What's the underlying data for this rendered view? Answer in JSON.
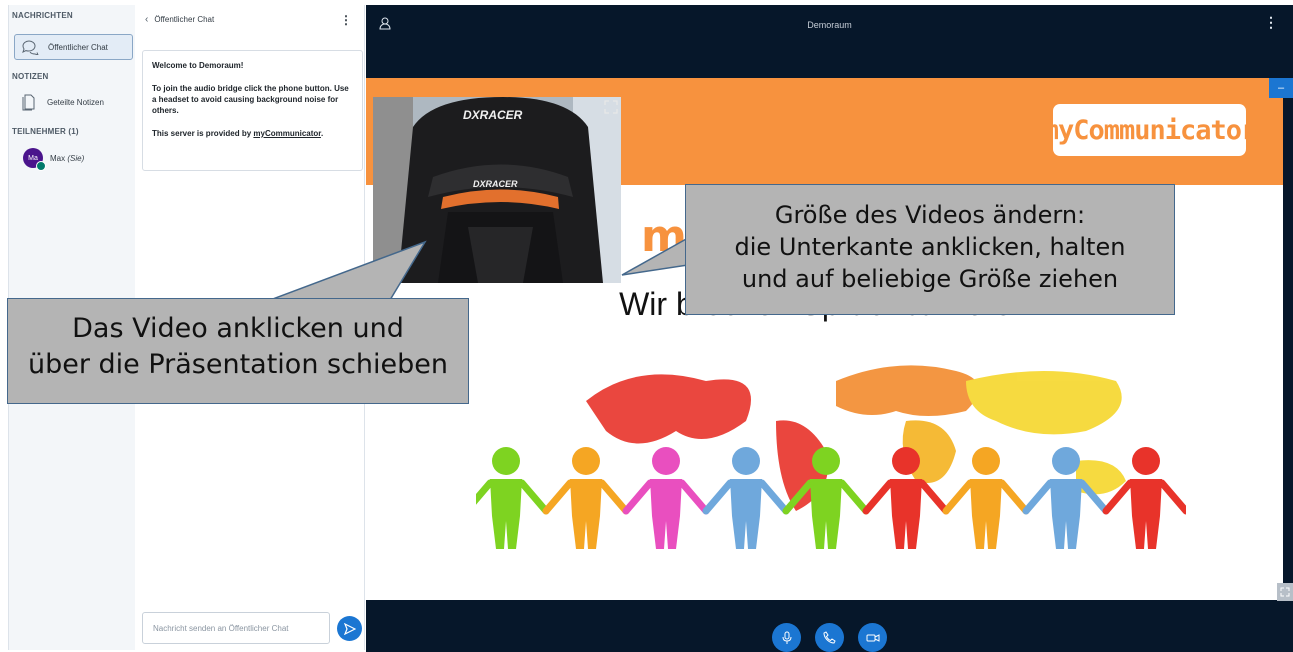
{
  "sidebar": {
    "messages_title": "NACHRICHTEN",
    "public_chat_label": "Öffentlicher Chat",
    "notes_title": "NOTIZEN",
    "shared_notes_label": "Geteilte Notizen",
    "participants_title": "TEILNEHMER (1)",
    "user": {
      "initials": "Ma",
      "name": "Max",
      "suffix": "(Sie)"
    }
  },
  "chat": {
    "header_title": "Öffentlicher Chat",
    "welcome_prefix": "Welcome to ",
    "welcome_room": "Demoraum",
    "welcome_suffix": "!",
    "instructions": "To join the audio bridge click the phone button. Use a headset to avoid causing background noise for others.",
    "provider_prefix": "This server is provided by ",
    "provider_link": "myCommunicator",
    "provider_suffix": ".",
    "input_placeholder": "Nachricht senden an Öffentlicher Chat"
  },
  "main": {
    "room_title": "Demoraum",
    "minimize_label": "–"
  },
  "slide": {
    "logo_text": "myCommunicator",
    "partial_heading": "m",
    "subtitle": "Wir brechen Sprachbarrieren"
  },
  "video": {
    "brand_top": "DXRACER",
    "brand_bottom": "DXRACER"
  },
  "callouts": {
    "left": [
      "Das Video anklicken und",
      "über die Präsentation schieben"
    ],
    "right": [
      "Größe des Videos ändern:",
      "die Unterkante anklicken, halten",
      "und auf beliebige Größe ziehen"
    ]
  },
  "colors": {
    "accent": "#1b76d2",
    "banner_orange": "#f7923e",
    "main_bg": "#06172a",
    "sidebar_bg": "#f3f6f9",
    "avatar": "#4a148c",
    "callout_bg": "#b4b4b4"
  }
}
